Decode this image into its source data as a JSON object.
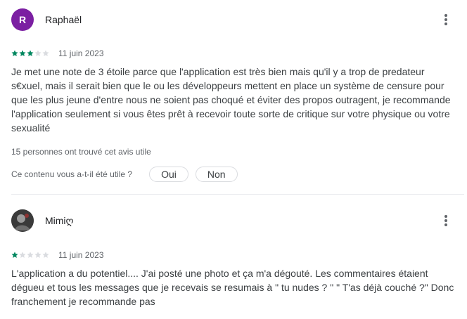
{
  "colors": {
    "avatar_1": "#7b1fa2",
    "star_filled": "#01875f",
    "star_empty": "#dadce0"
  },
  "reviews": [
    {
      "author": "Raphaël",
      "avatar_letter": "R",
      "rating": 3,
      "max_rating": 5,
      "date": "11 juin 2023",
      "text": "Je met une note de 3 étoile parce que l'application est très bien mais qu'il y a trop de predateur s€xuel, mais il serait bien que le ou les développeurs mettent en place un système de censure pour que les plus jeune d'entre nous ne soient pas choqué et éviter des propos outragent, je recommande l'application seulement si vous êtes prêt à recevoir toute sorte de critique sur votre physique ou votre sexualité",
      "helpful_count": "15 personnes ont trouvé cet avis utile",
      "feedback_question": "Ce contenu vous a-t-il été utile ?",
      "yes_label": "Oui",
      "no_label": "Non"
    },
    {
      "author": "Mimiღ",
      "rating": 1,
      "max_rating": 5,
      "date": "11 juin 2023",
      "text": "L'application a du potentiel.... J'ai posté une photo et ça m'a dégouté. Les commentaires étaient dégueu et tous les messages que je recevais se resumais à \" tu nudes ? \" \" T'as déjà couché ?\" Donc franchement je recommande pas"
    }
  ]
}
